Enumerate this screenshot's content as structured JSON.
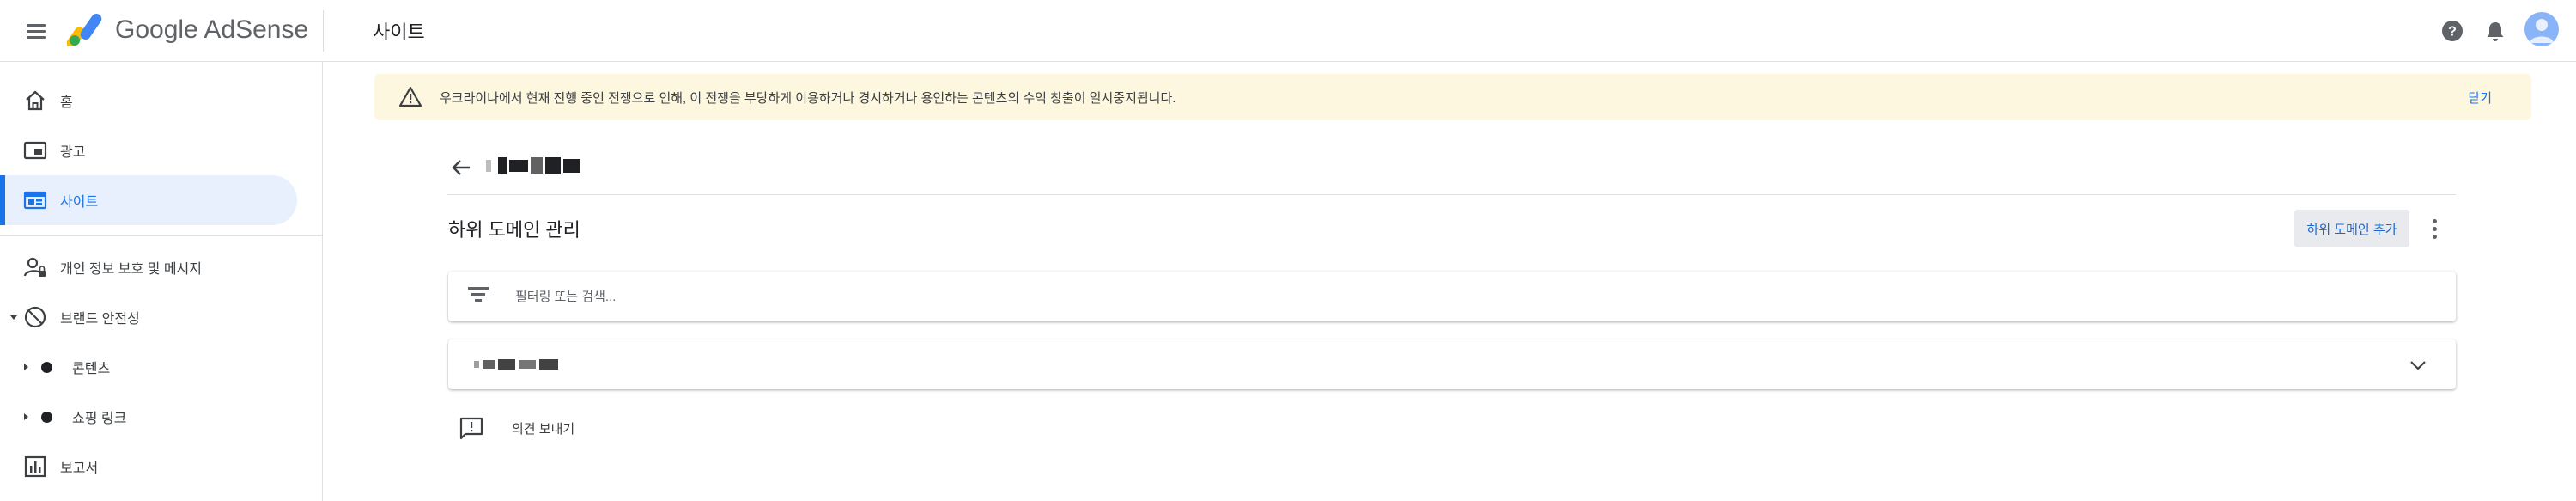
{
  "app": {
    "product_name": "Google AdSense",
    "page_heading": "사이트"
  },
  "sidebar": {
    "items": [
      {
        "label": "홈",
        "icon": "home-icon"
      },
      {
        "label": "광고",
        "icon": "ads-icon"
      },
      {
        "label": "사이트",
        "icon": "sites-icon",
        "active": true
      },
      {
        "label": "개인 정보 보호 및 메시지",
        "icon": "privacy-messaging-icon"
      },
      {
        "label": "브랜드 안전성",
        "icon": "block-icon",
        "expanded": true
      },
      {
        "label": "콘텐츠",
        "icon": "dot-icon"
      },
      {
        "label": "쇼핑 링크",
        "icon": "dot-icon"
      },
      {
        "label": "보고서",
        "icon": "reports-icon"
      }
    ]
  },
  "banner": {
    "text": "우크라이나에서 현재 진행 중인 전쟁으로 인해, 이 전쟁을 부당하게 이용하거나 경시하거나 용인하는 콘텐츠의 수익 창출이 일시중지됩니다.",
    "close_label": "닫기",
    "background": "#fef7e0"
  },
  "main": {
    "section_title": "하위 도메인 관리",
    "add_button_label": "하위 도메인 추가",
    "filter_placeholder": "필터링 또는 검색...",
    "feedback_label": "의견 보내기"
  },
  "colors": {
    "accent": "#1a73e8",
    "active_nav_bg": "#e8f0fe",
    "banner_bg": "#fef7e0"
  }
}
